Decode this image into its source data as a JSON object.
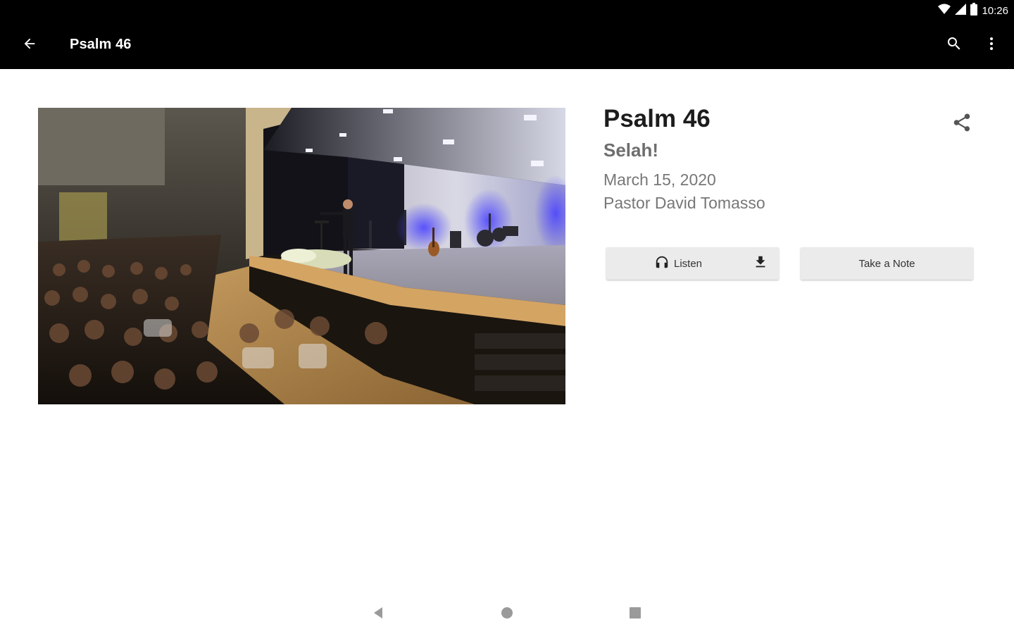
{
  "status_bar": {
    "time": "10:26",
    "icons": [
      "wifi-icon",
      "cell-signal-icon",
      "battery-icon"
    ]
  },
  "toolbar": {
    "title": "Psalm 46",
    "back_icon": "arrow-back-icon",
    "search_icon": "search-icon",
    "more_icon": "more-vert-icon"
  },
  "sermon": {
    "title": "Psalm 46",
    "series": "Selah!",
    "date": "March 15, 2020",
    "speaker": "Pastor David Tomasso",
    "image_alt": "Pastor preaching on stage to a seated congregation"
  },
  "actions": {
    "listen_label": "Listen",
    "note_label": "Take a Note",
    "share_icon": "share-icon",
    "headphones_icon": "headphones-icon",
    "download_icon": "download-icon"
  },
  "nav_bar": {
    "buttons": [
      "back-triangle-icon",
      "home-circle-icon",
      "recents-square-icon"
    ]
  },
  "colors": {
    "toolbar_bg": "#000000",
    "button_bg": "#ebebeb",
    "title": "#1c1c1c",
    "subtitle": "#6e6e6e",
    "meta": "#777777"
  }
}
